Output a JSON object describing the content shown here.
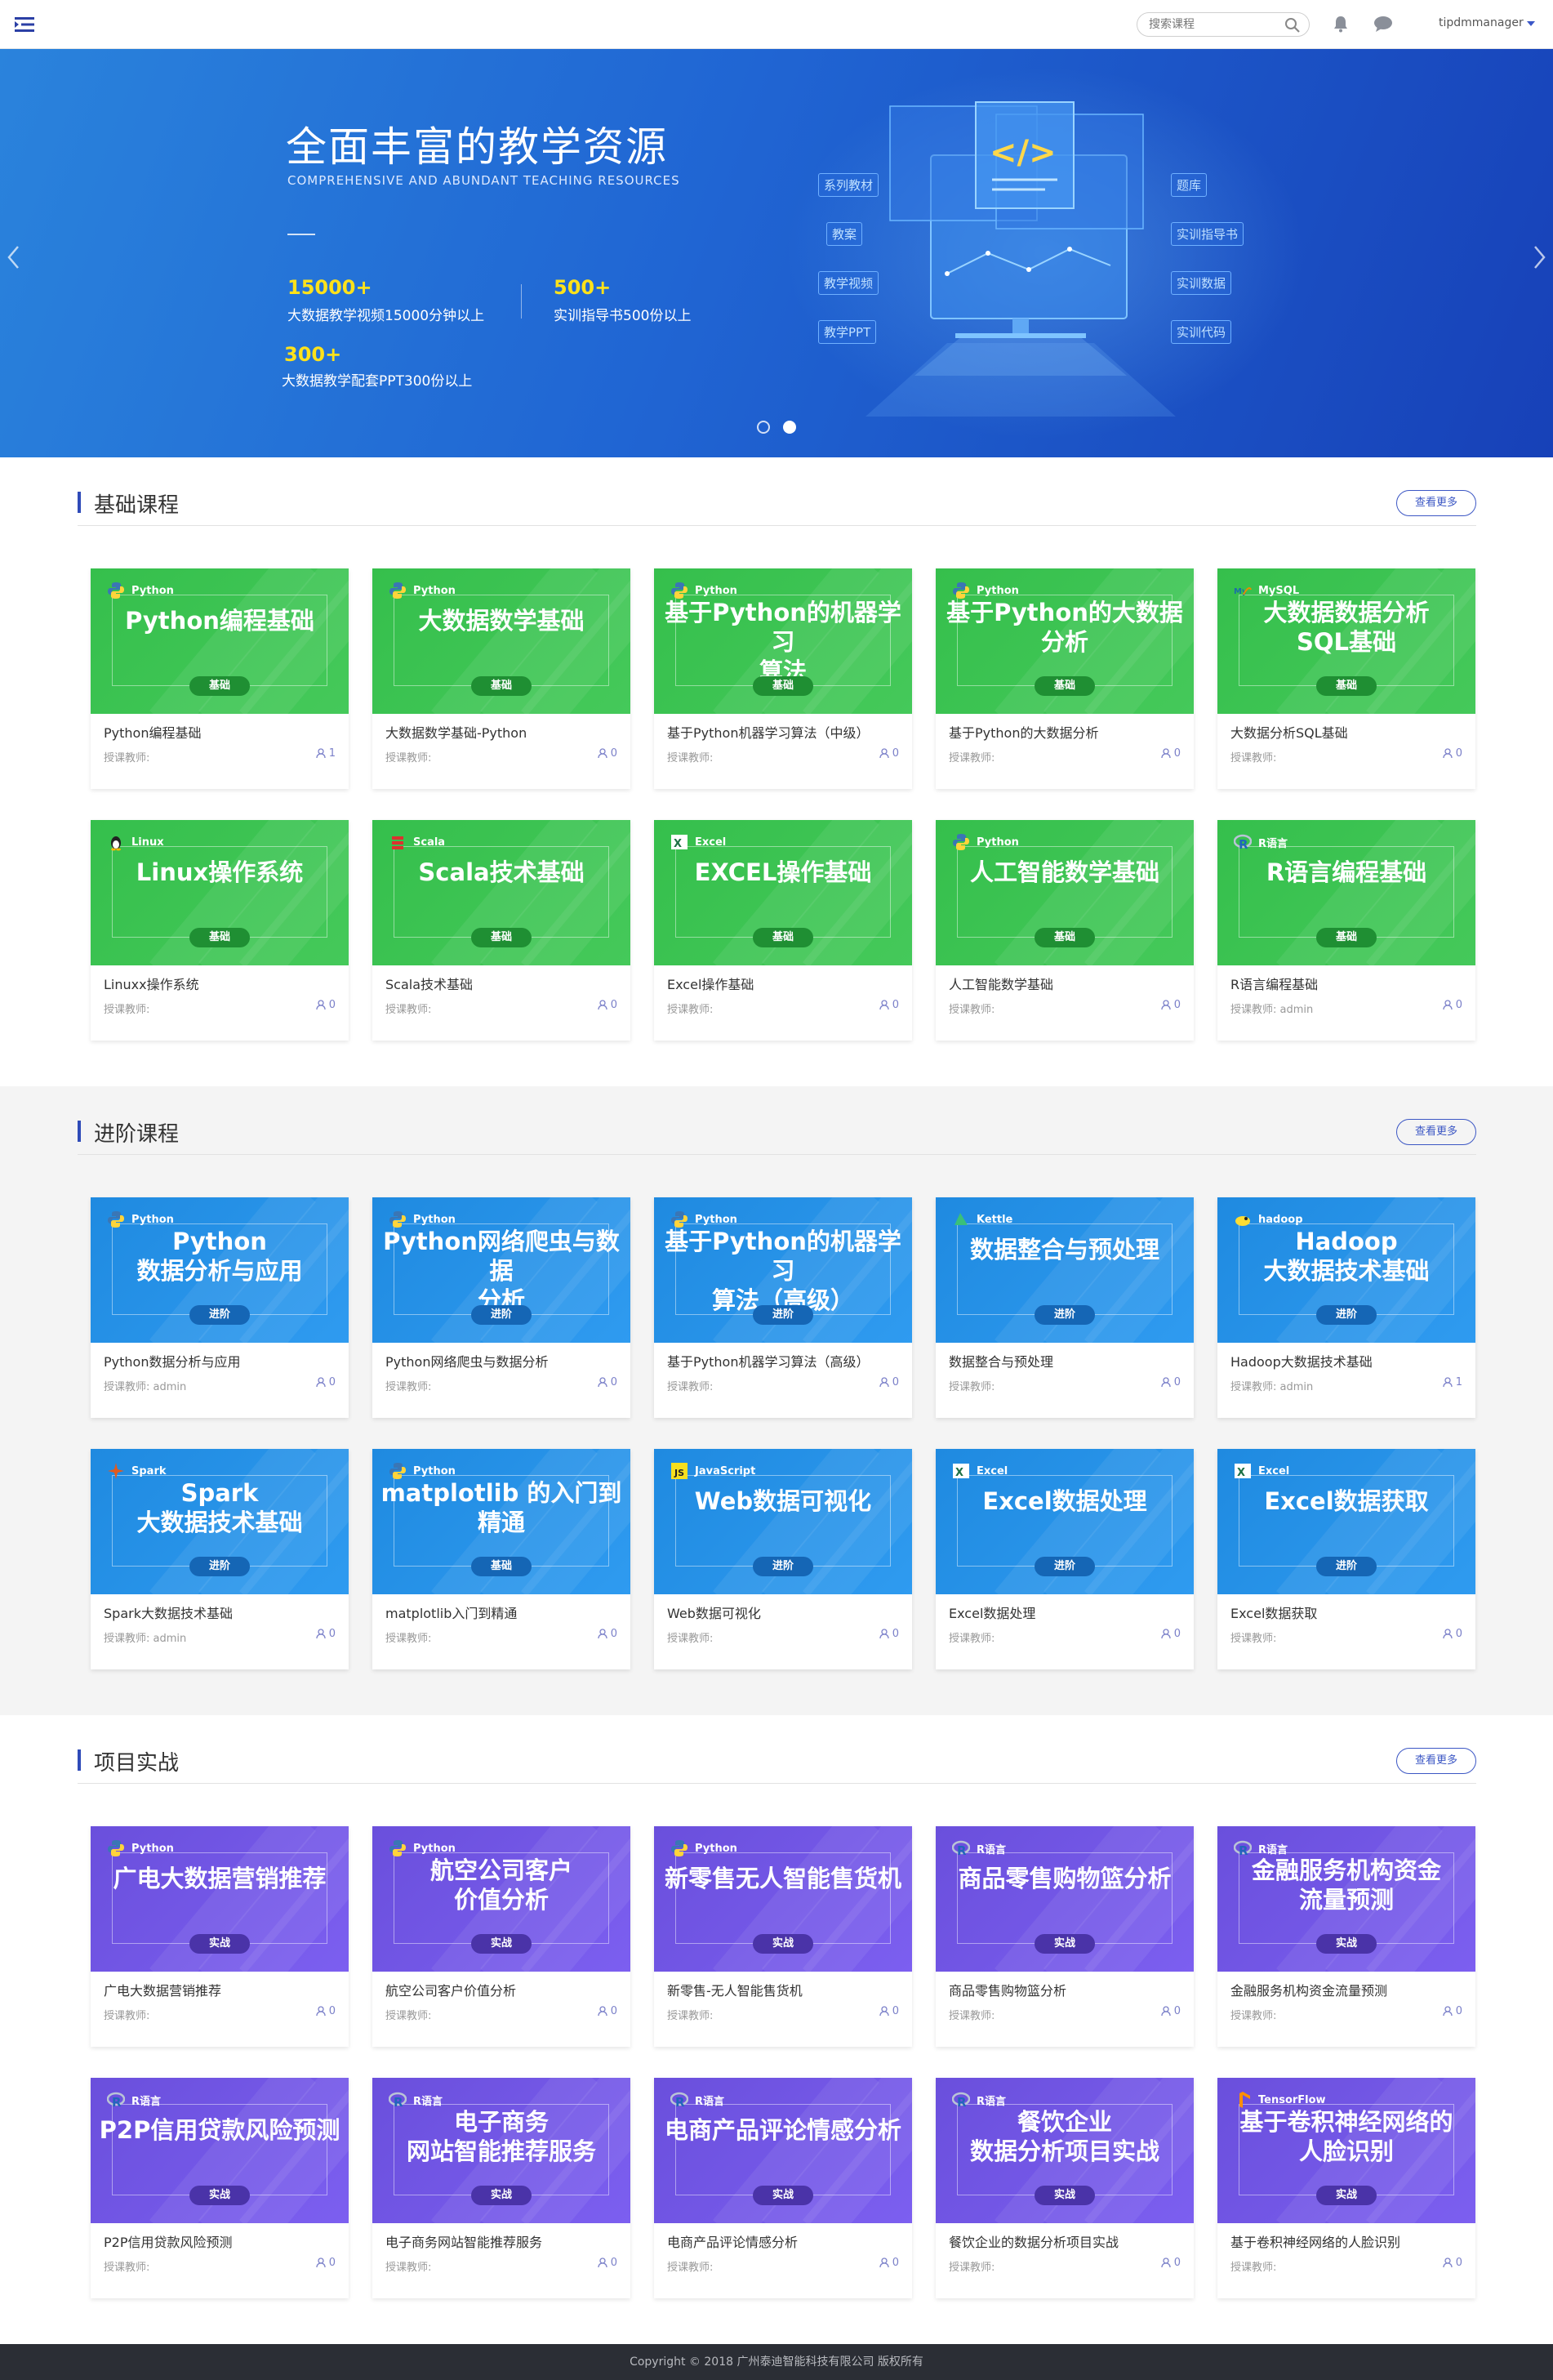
{
  "header": {
    "search_placeholder": "搜索课程",
    "username": "tipdmmanager"
  },
  "banner": {
    "title": "全面丰富的教学资源",
    "subtitle": "COMPREHENSIVE AND ABUNDANT TEACHING RESOURCES",
    "stats": [
      {
        "num": "15000+",
        "text": "大数据教学视频15000分钟以上"
      },
      {
        "num": "500+",
        "text": "实训指导书500份以上"
      },
      {
        "num": "300+",
        "text": "大数据教学配套PPT300份以上"
      }
    ],
    "illustration_tags_left": [
      "系列教材",
      "教案",
      "教学视频",
      "教学PPT"
    ],
    "illustration_tags_right": [
      "题库",
      "实训指导书",
      "实训数据",
      "实训代码"
    ],
    "code_glyph": "</>"
  },
  "sections": [
    {
      "title": "基础课程",
      "more": "查看更多",
      "theme": "green",
      "courses": [
        {
          "logo": "Python",
          "icon": "python-icon",
          "thumb_lines": [
            "Python编程基础"
          ],
          "level": "基础",
          "name": "Python编程基础",
          "teacher": "授课教师:",
          "count": "1"
        },
        {
          "logo": "Python",
          "icon": "python-icon",
          "thumb_lines": [
            "大数据数学基础"
          ],
          "level": "基础",
          "name": "大数据数学基础-Python",
          "teacher": "授课教师:",
          "count": "0"
        },
        {
          "logo": "Python",
          "icon": "python-icon",
          "thumb_lines": [
            "基于Python的机器学习",
            "算法"
          ],
          "level": "基础",
          "name": "基于Python机器学习算法（中级）",
          "teacher": "授课教师:",
          "count": "0"
        },
        {
          "logo": "Python",
          "icon": "python-icon",
          "thumb_lines": [
            "基于Python的大数据",
            "分析"
          ],
          "level": "基础",
          "name": "基于Python的大数据分析",
          "teacher": "授课教师:",
          "count": "0"
        },
        {
          "logo": "MySQL",
          "icon": "mysql-icon",
          "thumb_lines": [
            "大数据数据分析",
            "SQL基础"
          ],
          "level": "基础",
          "name": "大数据分析SQL基础",
          "teacher": "授课教师:",
          "count": "0"
        },
        {
          "logo": "Linux",
          "icon": "linux-icon",
          "thumb_lines": [
            "Linux操作系统"
          ],
          "level": "基础",
          "name": "Linuxx操作系统",
          "teacher": "授课教师:",
          "count": "0"
        },
        {
          "logo": "Scala",
          "icon": "scala-icon",
          "thumb_lines": [
            "Scala技术基础"
          ],
          "level": "基础",
          "name": "Scala技术基础",
          "teacher": "授课教师:",
          "count": "0"
        },
        {
          "logo": "Excel",
          "icon": "excel-icon",
          "thumb_lines": [
            "EXCEL操作基础"
          ],
          "level": "基础",
          "name": "Excel操作基础",
          "teacher": "授课教师:",
          "count": "0"
        },
        {
          "logo": "Python",
          "icon": "python-icon",
          "thumb_lines": [
            "人工智能数学基础"
          ],
          "level": "基础",
          "name": "人工智能数学基础",
          "teacher": "授课教师:",
          "count": "0"
        },
        {
          "logo": "R语言",
          "icon": "r-icon",
          "thumb_lines": [
            "R语言编程基础"
          ],
          "level": "基础",
          "name": "R语言编程基础",
          "teacher": "授课教师:  admin",
          "count": "0"
        }
      ]
    },
    {
      "title": "进阶课程",
      "more": "查看更多",
      "theme": "blue",
      "courses": [
        {
          "logo": "Python",
          "icon": "python-icon",
          "thumb_lines": [
            "Python",
            "数据分析与应用"
          ],
          "level": "进阶",
          "name": "Python数据分析与应用",
          "teacher": "授课教师:  admin",
          "count": "0"
        },
        {
          "logo": "Python",
          "icon": "python-icon",
          "thumb_lines": [
            "Python网络爬虫与数据",
            "分析"
          ],
          "level": "进阶",
          "name": "Python网络爬虫与数据分析",
          "teacher": "授课教师:",
          "count": "0"
        },
        {
          "logo": "Python",
          "icon": "python-icon",
          "thumb_lines": [
            "基于Python的机器学习",
            "算法（高级）"
          ],
          "level": "进阶",
          "name": "基于Python机器学习算法（高级）",
          "teacher": "授课教师:",
          "count": "0"
        },
        {
          "logo": "Kettle",
          "icon": "kettle-icon",
          "thumb_lines": [
            "数据整合与预处理"
          ],
          "level": "进阶",
          "name": "数据整合与预处理",
          "teacher": "授课教师:",
          "count": "0"
        },
        {
          "logo": "hadoop",
          "icon": "hadoop-icon",
          "thumb_lines": [
            "Hadoop",
            "大数据技术基础"
          ],
          "level": "进阶",
          "name": "Hadoop大数据技术基础",
          "teacher": "授课教师:  admin",
          "count": "1"
        },
        {
          "logo": "Spark",
          "icon": "spark-icon",
          "thumb_lines": [
            "Spark",
            "大数据技术基础"
          ],
          "level": "进阶",
          "name": "Spark大数据技术基础",
          "teacher": "授课教师:  admin",
          "count": "0"
        },
        {
          "logo": "Python",
          "icon": "python-icon",
          "thumb_lines": [
            "matplotlib 的入门到",
            "精通"
          ],
          "level": "基础",
          "name": "matplotlib入门到精通",
          "teacher": "授课教师:",
          "count": "0"
        },
        {
          "logo": "JavaScript",
          "icon": "javascript-icon",
          "thumb_lines": [
            "Web数据可视化"
          ],
          "level": "进阶",
          "name": "Web数据可视化",
          "teacher": "授课教师:",
          "count": "0"
        },
        {
          "logo": "Excel",
          "icon": "excel-icon",
          "thumb_lines": [
            "Excel数据处理"
          ],
          "level": "进阶",
          "name": "Excel数据处理",
          "teacher": "授课教师:",
          "count": "0"
        },
        {
          "logo": "Excel",
          "icon": "excel-icon",
          "thumb_lines": [
            "Excel数据获取"
          ],
          "level": "进阶",
          "name": "Excel数据获取",
          "teacher": "授课教师:",
          "count": "0"
        }
      ]
    },
    {
      "title": "项目实战",
      "more": "查看更多",
      "theme": "purple",
      "courses": [
        {
          "logo": "Python",
          "icon": "python-icon",
          "thumb_lines": [
            "广电大数据营销推荐"
          ],
          "level": "实战",
          "name": "广电大数据营销推荐",
          "teacher": "授课教师:",
          "count": "0"
        },
        {
          "logo": "Python",
          "icon": "python-icon",
          "thumb_lines": [
            "航空公司客户",
            "价值分析"
          ],
          "level": "实战",
          "name": "航空公司客户价值分析",
          "teacher": "授课教师:",
          "count": "0"
        },
        {
          "logo": "Python",
          "icon": "python-icon",
          "thumb_lines": [
            "新零售无人智能售货机"
          ],
          "level": "实战",
          "name": "新零售-无人智能售货机",
          "teacher": "授课教师:",
          "count": "0"
        },
        {
          "logo": "R语言",
          "icon": "r-icon",
          "thumb_lines": [
            "商品零售购物篮分析"
          ],
          "level": "实战",
          "name": "商品零售购物篮分析",
          "teacher": "授课教师:",
          "count": "0"
        },
        {
          "logo": "R语言",
          "icon": "r-icon",
          "thumb_lines": [
            "金融服务机构资金",
            "流量预测"
          ],
          "level": "实战",
          "name": "金融服务机构资金流量预测",
          "teacher": "授课教师:",
          "count": "0"
        },
        {
          "logo": "R语言",
          "icon": "r-icon",
          "thumb_lines": [
            "P2P信用贷款风险预测"
          ],
          "level": "实战",
          "name": "P2P信用贷款风险预测",
          "teacher": "授课教师:",
          "count": "0"
        },
        {
          "logo": "R语言",
          "icon": "r-icon",
          "thumb_lines": [
            "电子商务",
            "网站智能推荐服务"
          ],
          "level": "实战",
          "name": "电子商务网站智能推荐服务",
          "teacher": "授课教师:",
          "count": "0"
        },
        {
          "logo": "R语言",
          "icon": "r-icon",
          "thumb_lines": [
            "电商产品评论情感分析"
          ],
          "level": "实战",
          "name": "电商产品评论情感分析",
          "teacher": "授课教师:",
          "count": "0"
        },
        {
          "logo": "R语言",
          "icon": "r-icon",
          "thumb_lines": [
            "餐饮企业",
            "数据分析项目实战"
          ],
          "level": "实战",
          "name": "餐饮企业的数据分析项目实战",
          "teacher": "授课教师:",
          "count": "0"
        },
        {
          "logo": "TensorFlow",
          "icon": "tensorflow-icon",
          "thumb_lines": [
            "基于卷积神经网络的",
            "人脸识别"
          ],
          "level": "实战",
          "name": "基于卷积神经网络的人脸识别",
          "teacher": "授课教师:",
          "count": "0"
        }
      ]
    }
  ],
  "themes": {
    "green": {
      "bg": "#35bf4c",
      "bg2": "#45c95a",
      "badge": "#1f8f33"
    },
    "blue": {
      "bg": "#1f8ae0",
      "bg2": "#2f9bf0",
      "badge": "#1566b5"
    },
    "purple": {
      "bg": "#6a4fdc",
      "bg2": "#7c5ff0",
      "badge": "#4a33a8"
    }
  },
  "footer": {
    "copyright": "Copyright © 2018 广州泰迪智能科技有限公司 版权所有"
  }
}
